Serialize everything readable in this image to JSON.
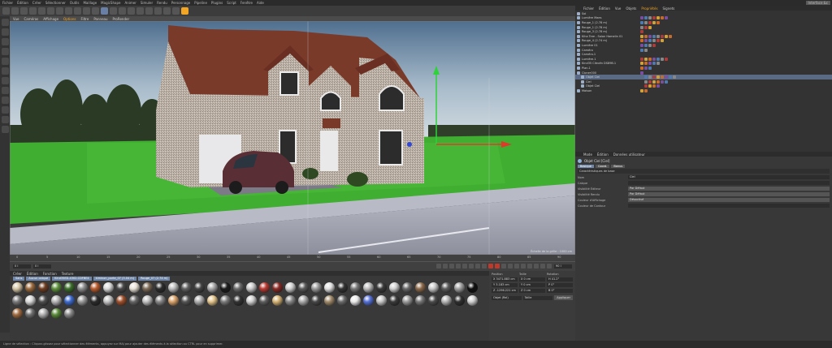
{
  "menu": {
    "items": [
      "Fichier",
      "Édition",
      "Créer",
      "Sélectionner",
      "Outils",
      "Maillage",
      "MagicShape",
      "Animer",
      "Simuler",
      "Rendu",
      "Personnage",
      "Pipeline",
      "Plugins",
      "Script",
      "Fenêtre",
      "Aide"
    ],
    "layout_right": "Interface &c"
  },
  "viewport": {
    "menu": [
      "Vue",
      "Caméras",
      "Affichage",
      "Options",
      "Filtre",
      "Panneau",
      "ProRender"
    ],
    "scale_label": "Échelle de la grille : 1000 cm"
  },
  "timeline": {
    "ticks": [
      "0",
      "5",
      "10",
      "15",
      "20",
      "25",
      "30",
      "35",
      "40",
      "45",
      "50",
      "55",
      "60",
      "65",
      "70",
      "75",
      "80",
      "85",
      "90"
    ],
    "start_field": "0 I",
    "frame_field": "0 I",
    "end_field": "90 I"
  },
  "materials": {
    "menu": [
      "Créer",
      "Édition",
      "Fonction",
      "Texture"
    ],
    "groups": [
      "Sans",
      "Aucun calque",
      "Kind35ED-4302-CDFBE4",
      "kiminon_porte_07 (3.04 m)",
      "Rouge_07 (2.74 m)"
    ]
  },
  "coords": {
    "headers": [
      "Position",
      "Taille",
      "Rotation"
    ],
    "rows": [
      {
        "pos": "X  3471.883 cm",
        "size": "X  0 cm",
        "rot": "H  41.2°"
      },
      {
        "pos": "Y  3.183 cm",
        "size": "Y  0 cm",
        "rot": "P  0°"
      },
      {
        "pos": "Z  -1296.221 cm",
        "size": "Z  0 cm",
        "rot": "B  0°"
      }
    ],
    "mode_select": "Objet (Rel)",
    "size_select": "Taille",
    "apply_label": "Appliquer"
  },
  "objects": {
    "menu": [
      "Fichier",
      "Édition",
      "Vue",
      "Objets",
      "Propriétés",
      "Signets"
    ],
    "items": [
      {
        "name": "Sol",
        "indent": 0,
        "selected": false
      },
      {
        "name": "Lumière Maes",
        "indent": 0,
        "selected": false
      },
      {
        "name": "Rouge_1 (2.78 m)",
        "indent": 0,
        "selected": false
      },
      {
        "name": "Rouge_1 (2.78 m)",
        "indent": 0,
        "selected": false
      },
      {
        "name": "Rouge_3 (2.78 m)",
        "indent": 0,
        "selected": false
      },
      {
        "name": "Kiha Tree - Salon Hamelin 01",
        "indent": 0,
        "selected": false
      },
      {
        "name": "Rouge_4 (2.74 m)",
        "indent": 0,
        "selected": false
      },
      {
        "name": "Lumière 01",
        "indent": 0,
        "selected": false
      },
      {
        "name": "Caméra",
        "indent": 0,
        "selected": false
      },
      {
        "name": "Caméra.1",
        "indent": 0,
        "selected": false
      },
      {
        "name": "Lumière.1",
        "indent": 0,
        "selected": false
      },
      {
        "name": "Kind35 Citroën DS89B.1",
        "indent": 0,
        "selected": false
      },
      {
        "name": "Plan.1",
        "indent": 0,
        "selected": false
      },
      {
        "name": "Cloner000",
        "indent": 0,
        "selected": false
      },
      {
        "name": "Objet Ciel",
        "indent": 1,
        "selected": true
      },
      {
        "name": "Ciel",
        "indent": 1,
        "selected": false
      },
      {
        "name": "Objet Ciel",
        "indent": 1,
        "selected": false
      },
      {
        "name": "Maison",
        "indent": 0,
        "selected": false
      }
    ]
  },
  "attributes": {
    "menu": [
      "Mode",
      "Édition",
      "Données utilisateur"
    ],
    "object_title": "Objet Ciel [Ciel]",
    "tabs": [
      "Basique",
      "Coord.",
      "Bonus"
    ],
    "section": "Caractéristiques de base",
    "fields": [
      {
        "label": "Nom",
        "value": "Ciel"
      },
      {
        "label": "Calque",
        "value": ""
      },
      {
        "label": "Visibilité Éditeur",
        "value": "Par Défaut"
      },
      {
        "label": "Visibilité Rendu",
        "value": "Par Défaut"
      },
      {
        "label": "Couleur d'Affichage",
        "value": "Désactivé"
      },
      {
        "label": "Couleur de Contour",
        "value": ""
      }
    ]
  },
  "status": {
    "text": "Ligne de sélection : Cliquez-glissez pour sélectionner des éléments, appuyez sur MAJ pour ajouter des éléments à la sélection ou CTRL pour en supprimer."
  },
  "colors": {
    "menubar": "#2b2b2b",
    "panel": "#333333",
    "accent": "#6f86a8",
    "selection": "#5a6a84",
    "grass": "#3fae31",
    "roof": "#7a3a2a",
    "sky_top": "#5f7f9e",
    "orange_highlight": "#f2a624"
  }
}
